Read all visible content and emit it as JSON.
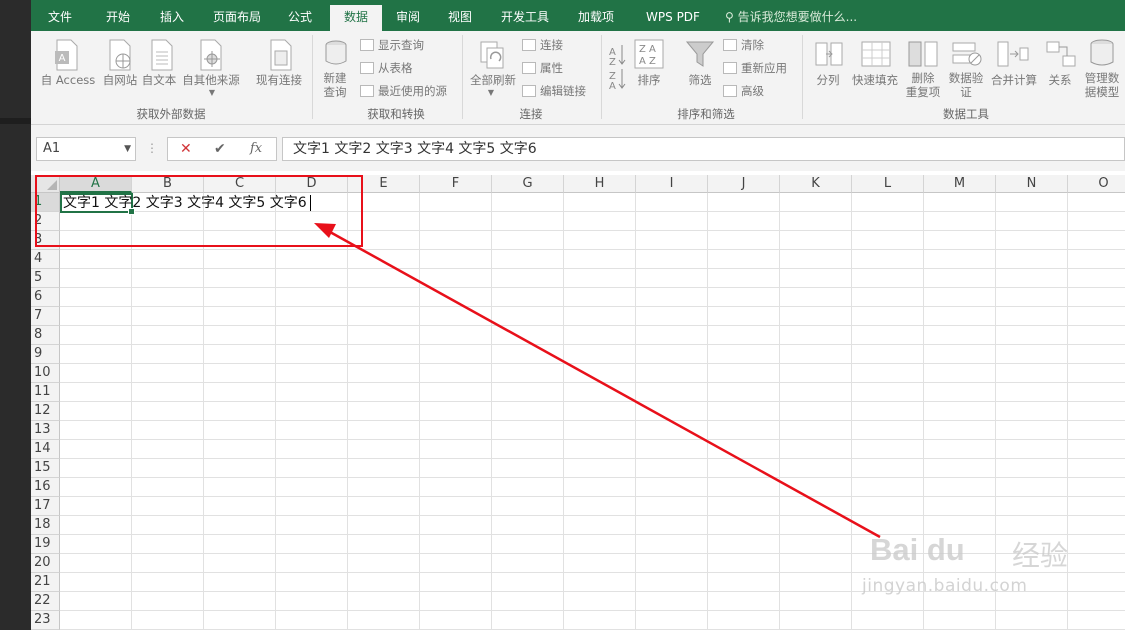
{
  "tabs": [
    {
      "label": "文件",
      "active": false
    },
    {
      "label": "开始",
      "active": false
    },
    {
      "label": "插入",
      "active": false
    },
    {
      "label": "页面布局",
      "active": false
    },
    {
      "label": "公式",
      "active": false
    },
    {
      "label": "数据",
      "active": true
    },
    {
      "label": "审阅",
      "active": false
    },
    {
      "label": "视图",
      "active": false
    },
    {
      "label": "开发工具",
      "active": false
    },
    {
      "label": "加载项",
      "active": false
    },
    {
      "label": "WPS PDF",
      "active": false
    }
  ],
  "tell_me": "告诉我您想要做什么...",
  "ribbon": {
    "get_external": {
      "label": "获取外部数据",
      "from_access": "自 Access",
      "from_web": "自网站",
      "from_text": "自文本",
      "from_other": "自其他来源",
      "existing": "现有连接"
    },
    "get_transform": {
      "label": "获取和转换",
      "new_query_1": "新建",
      "new_query_2": "查询",
      "show_queries": "显示查询",
      "from_table": "从表格",
      "recent_sources": "最近使用的源"
    },
    "connections": {
      "label": "连接",
      "refresh_all": "全部刷新",
      "connections": "连接",
      "properties": "属性",
      "edit_links": "编辑链接"
    },
    "sort_filter": {
      "label": "排序和筛选",
      "sort": "排序",
      "filter": "筛选",
      "clear": "清除",
      "reapply": "重新应用",
      "advanced": "高级"
    },
    "data_tools": {
      "label": "数据工具",
      "text_to_columns": "分列",
      "flash_fill": "快速填充",
      "remove_dup_1": "删除",
      "remove_dup_2": "重复项",
      "validation_1": "数据验",
      "validation_2": "证",
      "consolidate": "合并计算",
      "relationships": "关系",
      "data_model_1": "管理数",
      "data_model_2": "据模型"
    }
  },
  "formula_bar": {
    "name_box": "A1",
    "fx": "fx",
    "content": "文字1 文字2 文字3 文字4 文字5 文字6"
  },
  "columns": [
    "A",
    "B",
    "C",
    "D",
    "E",
    "F",
    "G",
    "H",
    "I",
    "J",
    "K",
    "L",
    "M",
    "N",
    "O"
  ],
  "rows": [
    "1",
    "2",
    "3",
    "4",
    "5",
    "6",
    "7",
    "8",
    "9",
    "10",
    "11",
    "12",
    "13",
    "14",
    "15",
    "16",
    "17",
    "18",
    "19",
    "20",
    "21",
    "22",
    "23"
  ],
  "cell_a1": "文字1 文字2 文字3 文字4 文字5 文字6",
  "watermark": {
    "brand": "Bai du",
    "jingyan": "经验",
    "url": "jingyan.baidu.com"
  },
  "colors": {
    "excel_green": "#217346",
    "annotation_red": "#e8101a"
  }
}
